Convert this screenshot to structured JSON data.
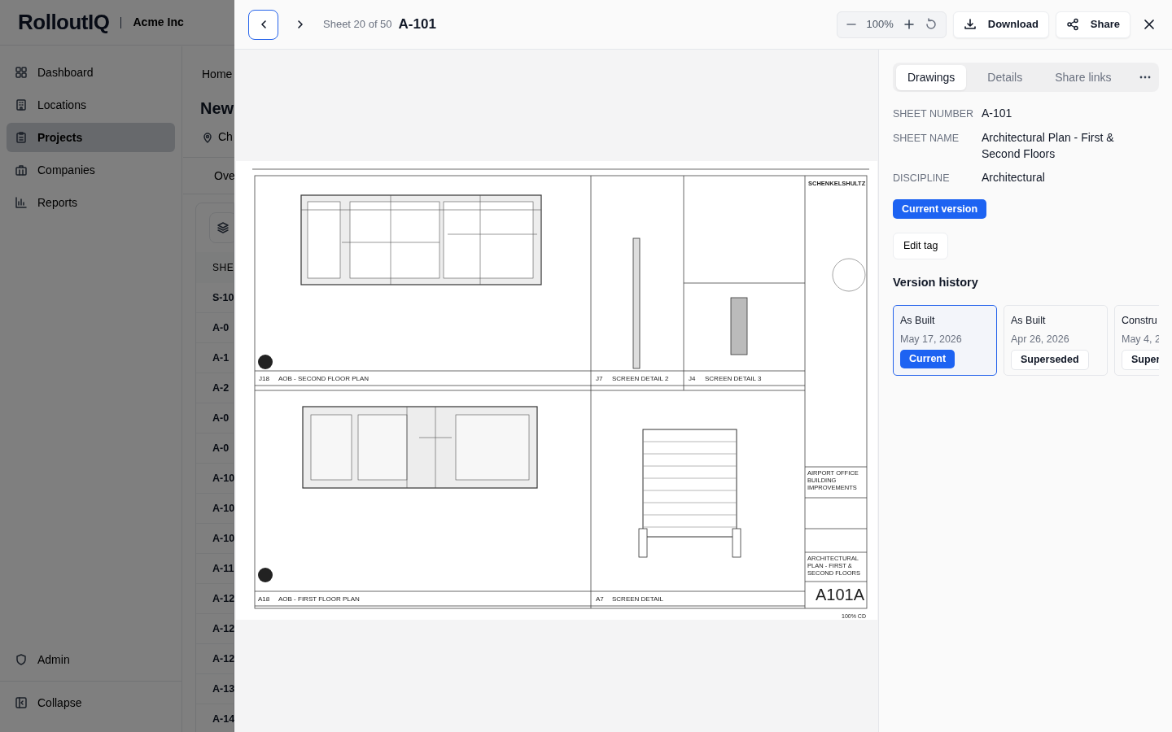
{
  "app": {
    "logo": "RolloutIQ",
    "org": "Acme Inc",
    "sidebar": {
      "items": [
        {
          "label": "Dashboard",
          "selected": false
        },
        {
          "label": "Locations",
          "selected": false
        },
        {
          "label": "Projects",
          "selected": true
        },
        {
          "label": "Companies",
          "selected": false
        },
        {
          "label": "Reports",
          "selected": false
        }
      ],
      "admin": "Admin",
      "collapse": "Collapse"
    },
    "page": {
      "breadcrumb": "Home",
      "title": "New",
      "location": "Ch",
      "tab": "Ove",
      "table": {
        "column_1": "SHE",
        "rows": [
          "S-10",
          "A-0",
          "A-1",
          "A-2",
          "A-0",
          "A-0",
          "A-10",
          "A-10",
          "A-10",
          "A-11",
          "A-12",
          "A-12",
          "A-12",
          "A-13",
          "A-14"
        ]
      }
    }
  },
  "viewer": {
    "sheet_position": "Sheet 20 of 50",
    "sheet_number": "A-101",
    "zoom": "100%",
    "buttons": [
      "Download",
      "Share"
    ]
  },
  "sheet": {
    "labels": [
      "J18",
      "AOB - SECOND FLOOR PLAN",
      "J7",
      "SCREEN DETAIL 2",
      "J4",
      "SCREEN DETAIL 3",
      "A18",
      "AOB - FIRST FLOOR PLAN",
      "A7",
      "SCREEN DETAIL",
      "SCHENKELSHULTZ",
      "AIRPORT OFFICE BUILDING IMPROVEMENTS",
      "ARCHITECTURAL PLAN - FIRST & SECOND FLOORS",
      "A101A",
      "100% CD"
    ]
  },
  "panel": {
    "tabs": [
      {
        "label": "Drawings",
        "selected": true
      },
      {
        "label": "Details",
        "selected": false
      },
      {
        "label": "Share links",
        "selected": false
      }
    ],
    "fields": [
      {
        "label": "SHEET NUMBER",
        "value": "A-101"
      },
      {
        "label": "SHEET NAME",
        "value": "Architectural Plan - First & Second Floors"
      },
      {
        "label": "DISCIPLINE",
        "value": "Architectural"
      }
    ],
    "version_tag": "Current version",
    "edit_tag": "Edit tag",
    "history_title": "Version history",
    "versions": [
      {
        "name": "As Built",
        "date": "May 17, 2026",
        "status": "Current",
        "kind": "current",
        "selected": true
      },
      {
        "name": "As Built",
        "date": "Apr 26, 2026",
        "status": "Superseded",
        "kind": "superseded",
        "selected": false
      },
      {
        "name": "Constru",
        "date": "May 4, 2",
        "status": "Super",
        "kind": "superseded",
        "selected": false
      }
    ]
  }
}
